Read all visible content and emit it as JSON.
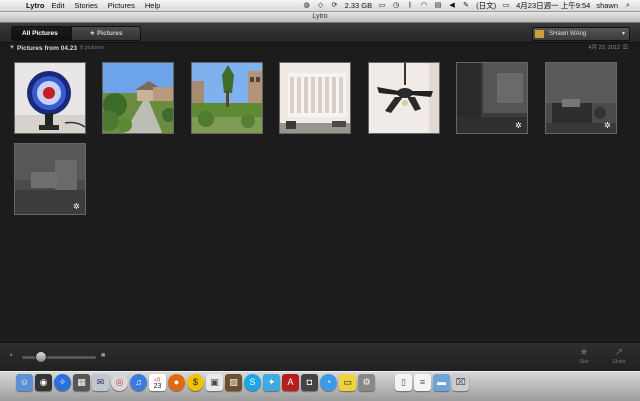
{
  "menubar": {
    "app_name": "Lytro",
    "menus": [
      "Edit",
      "Stories",
      "Pictures",
      "Help"
    ],
    "storage": "2.33 GB",
    "input_method": "(日文)",
    "datetime": "4月23日週一 上午9:54",
    "user": "shawn"
  },
  "window": {
    "title": "Lytro"
  },
  "toolbar": {
    "tab_all": "All Pictures",
    "tab_starred": "★ Pictures",
    "user_name": "SHawn WAng",
    "user_dropdown": "▾"
  },
  "section": {
    "title": "Pictures from 04.23",
    "count": "8 pictures",
    "date": "4月 23, 2012"
  },
  "thumbnails": [
    {
      "name": "fan-on-desk"
    },
    {
      "name": "suburban-street"
    },
    {
      "name": "backyard-tree"
    },
    {
      "name": "window-blinds-room"
    },
    {
      "name": "ceiling-fan"
    },
    {
      "name": "dark-room-1"
    },
    {
      "name": "dark-room-2"
    },
    {
      "name": "dark-desk"
    }
  ],
  "bottombar": {
    "star_label": "Star",
    "share_label": "Share",
    "zoom_fraction": 0.25
  },
  "dock": {
    "icons": [
      "finder-icon",
      "dashboard-icon",
      "safari-icon",
      "mission-control-icon",
      "mail-icon",
      "chrome-icon",
      "itunes-icon",
      "calendar-icon",
      "basketball-icon",
      "money-icon",
      "preview-icon",
      "photo-icon",
      "skype-icon",
      "twitter-icon",
      "acrobat-icon",
      "camera-icon",
      "messages-icon",
      "stickies-icon",
      "system-prefs-icon",
      "document-icon",
      "list-icon",
      "folder-icon",
      "trash-icon"
    ],
    "calendar_day": "23",
    "calendar_month": "4月"
  }
}
